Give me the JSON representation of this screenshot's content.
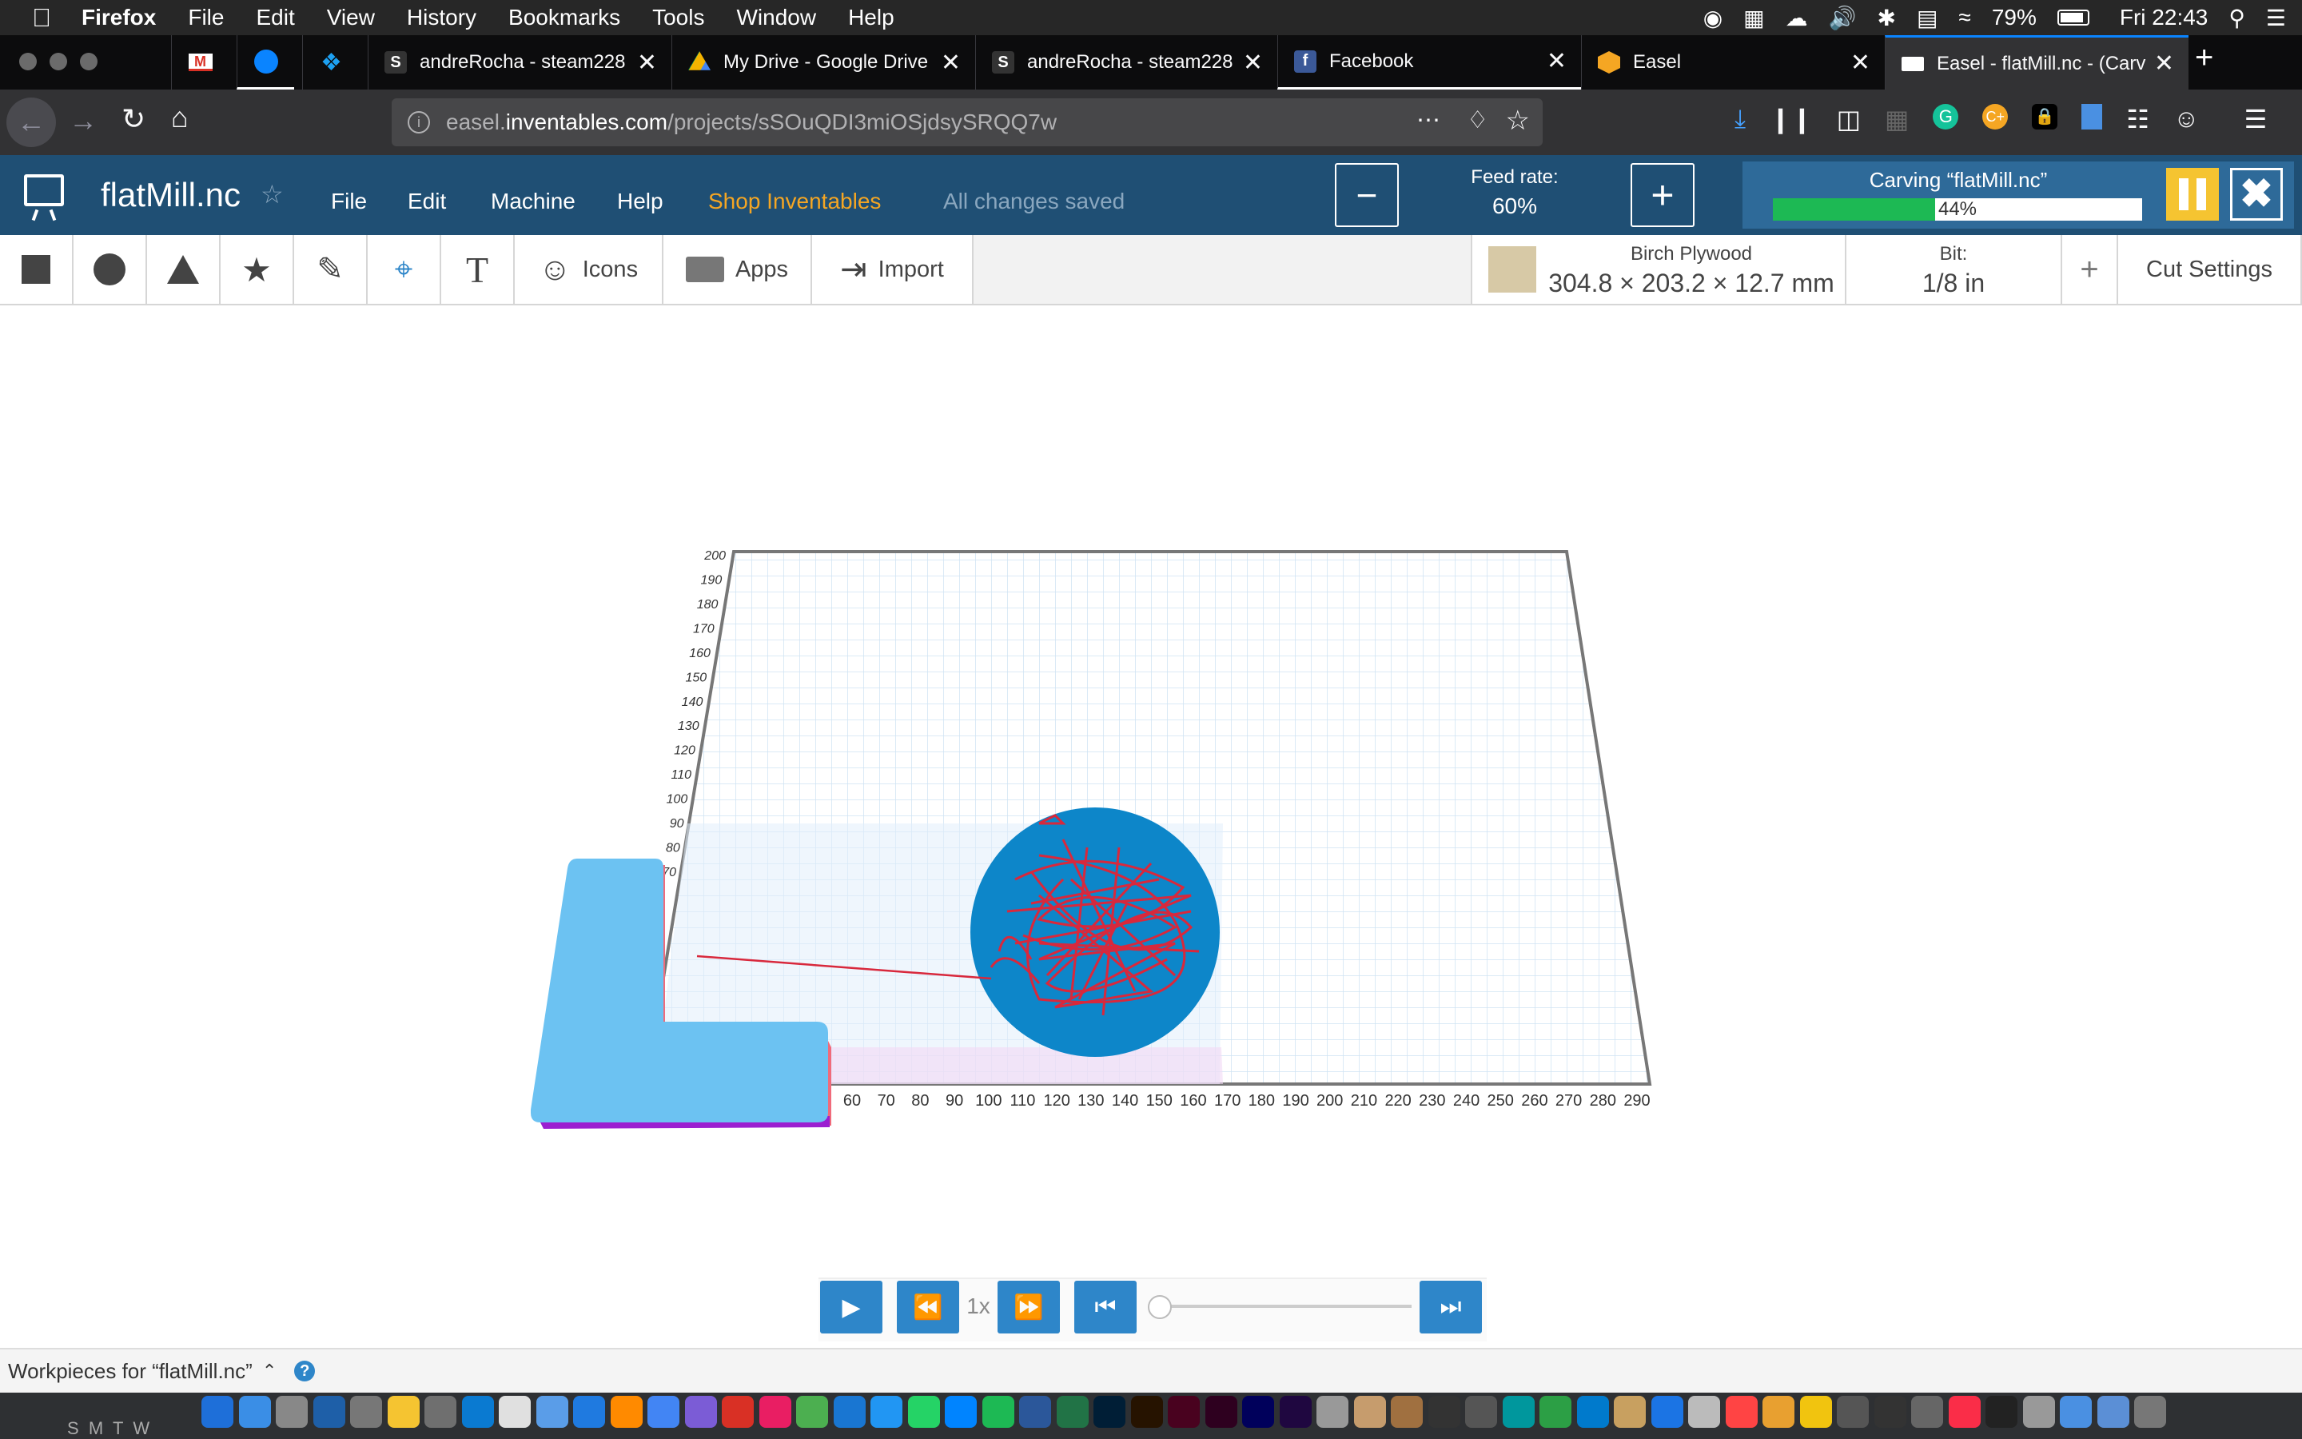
{
  "menubar": {
    "app": "Firefox",
    "items": [
      "File",
      "Edit",
      "View",
      "History",
      "Bookmarks",
      "Tools",
      "Window",
      "Help"
    ],
    "battery": "79%",
    "clock": "Fri 22:43"
  },
  "tabs": [
    {
      "label": "andreRocha - steam228",
      "icon": "S"
    },
    {
      "label": "My Drive - Google Drive",
      "icon": "drive"
    },
    {
      "label": "andreRocha - steam228",
      "icon": "S"
    },
    {
      "label": "Facebook",
      "icon": "f"
    },
    {
      "label": "Easel",
      "icon": "easel"
    },
    {
      "label": "Easel - flatMill.nc - (Carv",
      "icon": "easel-white"
    }
  ],
  "url": {
    "prefix": "easel.",
    "domain": "inventables.com",
    "path": "/projects/sSOuQDI3miOSjdsySRQQ7w"
  },
  "app": {
    "project_name": "flatMill.nc",
    "menu": [
      "File",
      "Edit",
      "Machine",
      "Help"
    ],
    "shop_link": "Shop Inventables",
    "save_status": "All changes saved",
    "feed_rate_label": "Feed rate:",
    "feed_rate_value": "60%",
    "carving_label": "Carving “flatMill.nc”",
    "progress_text": "44%",
    "progress_fraction": 0.44
  },
  "toolbar": {
    "icons_label": "Icons",
    "apps_label": "Apps",
    "import_label": "Import",
    "material_name": "Birch Plywood",
    "material_dims": "304.8 × 203.2 × 12.7 mm",
    "bit_label": "Bit:",
    "bit_value": "1/8 in",
    "cut_settings": "Cut Settings"
  },
  "preview": {
    "y_ticks": [
      "200",
      "190",
      "180",
      "170",
      "160",
      "150",
      "140",
      "130",
      "120",
      "110",
      "100",
      "90",
      "80",
      "70"
    ],
    "x_ticks": [
      "60",
      "70",
      "80",
      "90",
      "100",
      "110",
      "120",
      "130",
      "140",
      "150",
      "160",
      "170",
      "180",
      "190",
      "200",
      "210",
      "220",
      "230",
      "240",
      "250",
      "260",
      "270",
      "280",
      "290"
    ]
  },
  "playback": {
    "speed": "1x",
    "slider_fraction": 0.0
  },
  "workpieces_label": "Workpieces for “flatMill.nc”",
  "calendar_letters": "S  M  T  W",
  "colors": {
    "header": "#1f4f74",
    "accent_blue": "#2e86c9",
    "shop_orange": "#f5a623",
    "progress_green": "#1db954",
    "pause_yellow": "#f5c431"
  }
}
